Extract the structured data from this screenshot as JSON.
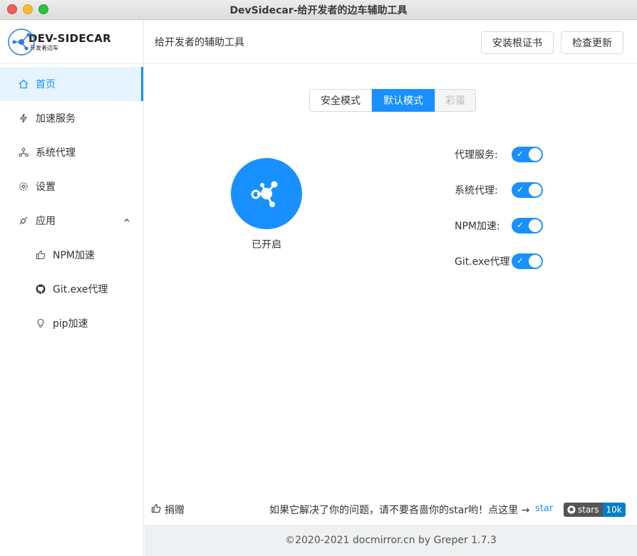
{
  "window": {
    "title": "DevSidecar-给开发者的边车辅助工具"
  },
  "logo": {
    "main": "DEV-SIDECAR",
    "sub": "开发者边车"
  },
  "sidebar": {
    "items": [
      {
        "label": "首页",
        "icon": "home-icon"
      },
      {
        "label": "加速服务",
        "icon": "thunder-icon"
      },
      {
        "label": "系统代理",
        "icon": "cluster-icon"
      },
      {
        "label": "设置",
        "icon": "gear-icon"
      },
      {
        "label": "应用",
        "icon": "api-icon"
      },
      {
        "label": "NPM加速",
        "icon": "like-icon"
      },
      {
        "label": "Git.exe代理",
        "icon": "github-icon"
      },
      {
        "label": "pip加速",
        "icon": "bulb-icon"
      }
    ]
  },
  "header": {
    "title": "给开发者的辅助工具",
    "install_cert": "安装根证书",
    "check_update": "检查更新"
  },
  "modes": {
    "safe": "安全模式",
    "default": "默认模式",
    "egg": "彩蛋",
    "selected": "默认模式"
  },
  "main": {
    "status": "已开启"
  },
  "toggles": [
    {
      "label": "代理服务:",
      "on": true
    },
    {
      "label": "系统代理:",
      "on": true
    },
    {
      "label": "NPM加速:",
      "on": true
    },
    {
      "label": "Git.exe代理",
      "on": true
    }
  ],
  "bottom": {
    "donate": "捐赠",
    "star_prompt": "如果它解决了你的问题，请不要吝啬你的star哟！点这里 →",
    "star_alt": "star",
    "badge_label": "stars",
    "badge_count": "10k"
  },
  "footer": {
    "text": "©2020-2021 docmirror.cn by Greper 1.7.3"
  },
  "colors": {
    "accent": "#1890ff"
  }
}
